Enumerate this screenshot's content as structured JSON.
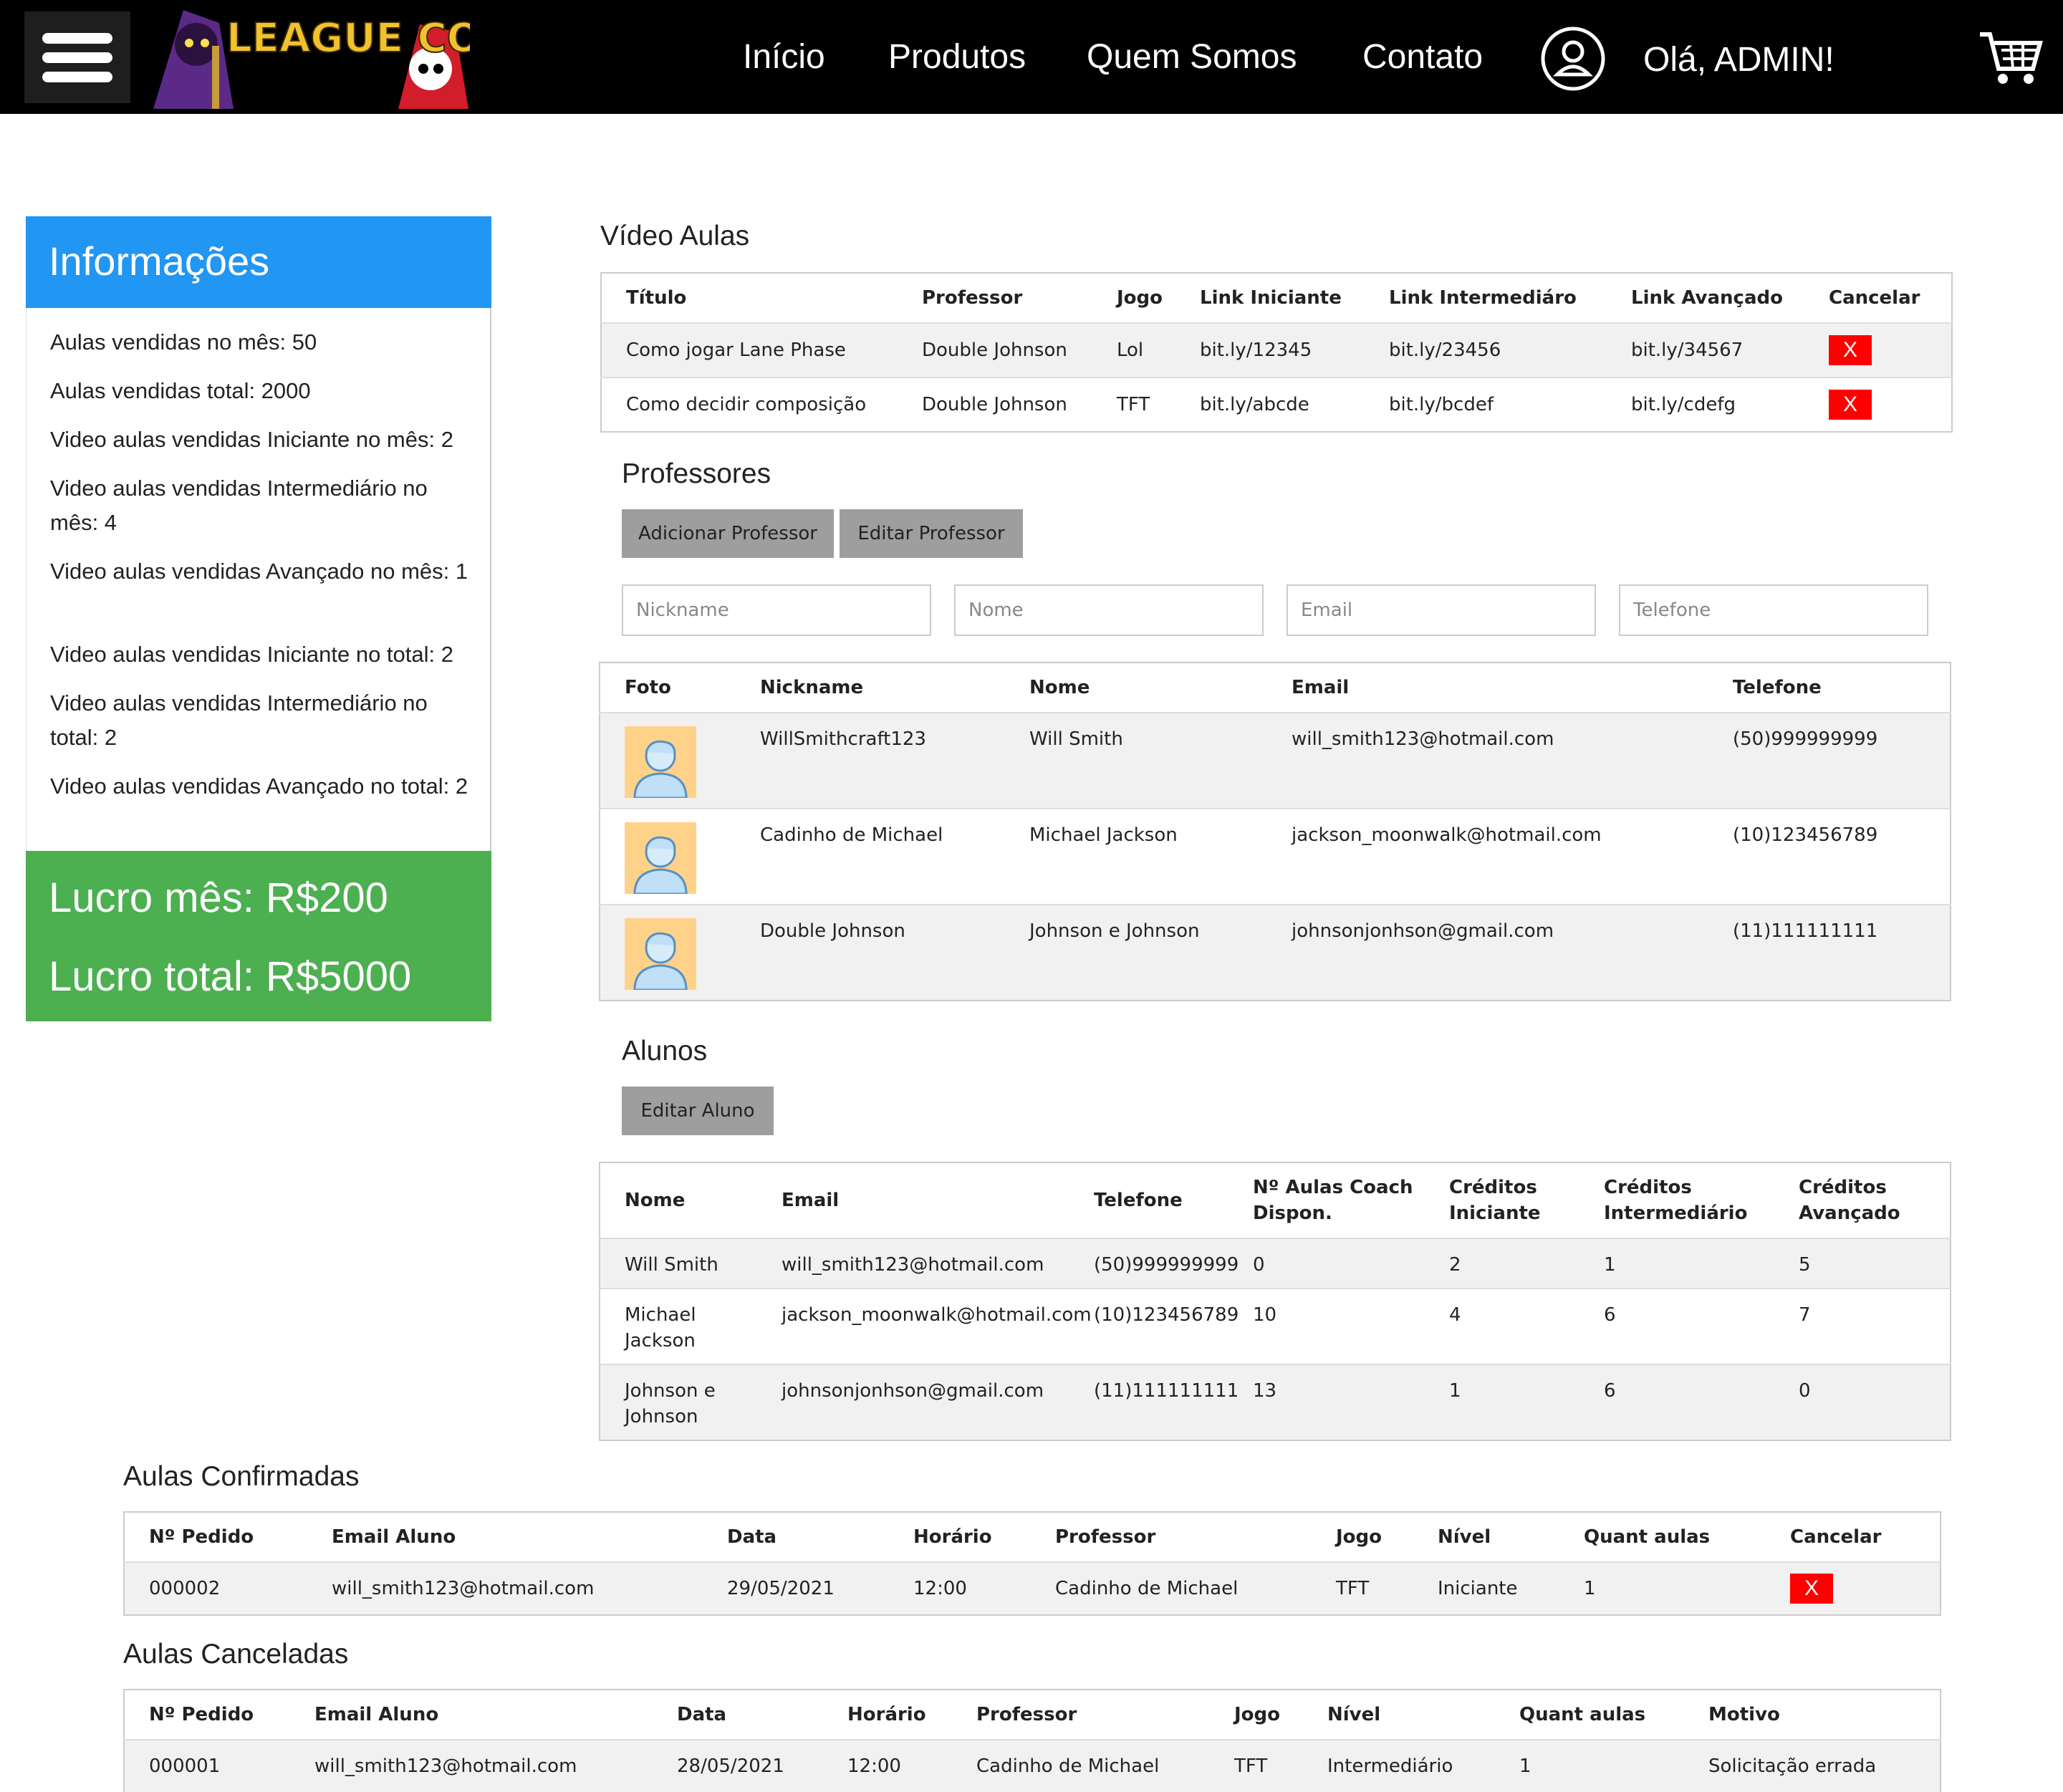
{
  "header": {
    "logo_text": "LEAGUE COACHING",
    "nav": [
      "Início",
      "Produtos",
      "Quem Somos",
      "Contato"
    ],
    "greeting": "Olá, ADMIN!",
    "icons": {
      "menu": "hamburger-icon",
      "user": "user-circle-icon",
      "cart": "cart-icon"
    }
  },
  "info": {
    "title": "Informações",
    "items": [
      "Aulas vendidas no mês: 50",
      "Aulas vendidas total: 2000",
      "Video aulas vendidas Iniciante no mês: 2",
      "Video aulas vendidas Intermediário no mês: 4",
      "Video aulas vendidas Avançado no mês: 1",
      "Video aulas vendidas Iniciante no total: 2",
      "Video aulas vendidas Intermediário no total: 2",
      "Video aulas vendidas Avançado no total: 2"
    ],
    "profit_month": "Lucro mês: R$200",
    "profit_total": "Lucro total: R$5000",
    "colors": {
      "header": "#2196F3",
      "profit": "#4CAF50"
    }
  },
  "video_aulas": {
    "title": "Vídeo Aulas",
    "headers": [
      "Título",
      "Professor",
      "Jogo",
      "Link Iniciante",
      "Link Intermediáro",
      "Link Avançado",
      "Cancelar"
    ],
    "rows": [
      [
        "Como jogar Lane Phase",
        "Double Johnson",
        "Lol",
        "bit.ly/12345",
        "bit.ly/23456",
        "bit.ly/34567"
      ],
      [
        "Como decidir composição",
        "Double Johnson",
        "TFT",
        "bit.ly/abcde",
        "bit.ly/bcdef",
        "bit.ly/cdefg"
      ]
    ],
    "cancel_label": "X"
  },
  "professores": {
    "title": "Professores",
    "add_button": "Adicionar Professor",
    "edit_button": "Editar Professor",
    "placeholders": {
      "nickname": "Nickname",
      "nome": "Nome",
      "email": "Email",
      "telefone": "Telefone"
    },
    "headers": [
      "Foto",
      "Nickname",
      "Nome",
      "Email",
      "Telefone"
    ],
    "rows": [
      [
        "WillSmithcraft123",
        "Will Smith",
        "will_smith123@hotmail.com",
        "(50)999999999"
      ],
      [
        "Cadinho de Michael",
        "Michael Jackson",
        "jackson_moonwalk@hotmail.com",
        "(10)123456789"
      ],
      [
        "Double Johnson",
        "Johnson e Johnson",
        "johnsonjonhson@gmail.com",
        "(11)111111111"
      ]
    ]
  },
  "alunos": {
    "title": "Alunos",
    "edit_button": "Editar Aluno",
    "headers": [
      "Nome",
      "Email",
      "Telefone",
      "Nº Aulas Coach Dispon.",
      "Créditos Iniciante",
      "Créditos Intermediário",
      "Créditos Avançado"
    ],
    "rows": [
      [
        "Will Smith",
        "will_smith123@hotmail.com",
        "(50)999999999",
        "0",
        "2",
        "1",
        "5"
      ],
      [
        "Michael Jackson",
        "jackson_moonwalk@hotmail.com",
        "(10)123456789",
        "10",
        "4",
        "6",
        "7"
      ],
      [
        "Johnson e Johnson",
        "johnsonjonhson@gmail.com",
        "(11)111111111",
        "13",
        "1",
        "6",
        "0"
      ]
    ]
  },
  "confirmadas": {
    "title": "Aulas Confirmadas",
    "headers": [
      "Nº Pedido",
      "Email Aluno",
      "Data",
      "Horário",
      "Professor",
      "Jogo",
      "Nível",
      "Quant aulas",
      "Cancelar"
    ],
    "rows": [
      [
        "000002",
        "will_smith123@hotmail.com",
        "29/05/2021",
        "12:00",
        "Cadinho de Michael",
        "TFT",
        "Iniciante",
        "1"
      ]
    ],
    "cancel_label": "X"
  },
  "canceladas": {
    "title": "Aulas Canceladas",
    "headers": [
      "Nº Pedido",
      "Email Aluno",
      "Data",
      "Horário",
      "Professor",
      "Jogo",
      "Nível",
      "Quant aulas",
      "Motivo"
    ],
    "rows": [
      [
        "000001",
        "will_smith123@hotmail.com",
        "28/05/2021",
        "12:00",
        "Cadinho de Michael",
        "TFT",
        "Intermediário",
        "1",
        "Solicitação errada"
      ]
    ]
  }
}
